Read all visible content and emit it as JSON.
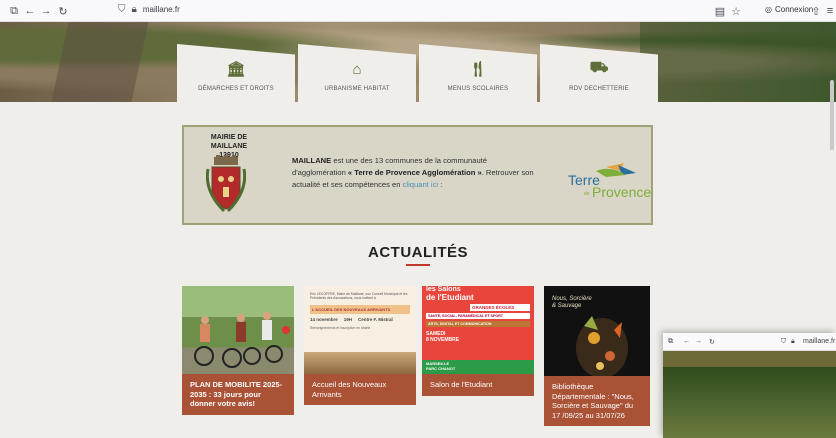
{
  "browser": {
    "url": "maillane.fr",
    "login_label": "Connexion"
  },
  "nav": {
    "items": [
      {
        "label": "DÉMARCHES ET DROITS",
        "icon": "bank-icon"
      },
      {
        "label": "URBANISME HABITAT",
        "icon": "house-icon"
      },
      {
        "label": "MENUS SCOLAIRES",
        "icon": "cutlery-icon"
      },
      {
        "label": "RDV DECHETTERIE",
        "icon": "truck-icon"
      }
    ]
  },
  "mairie": {
    "title_line1": "MAIRIE DE MAILLANE",
    "title_line2": "13910",
    "text_strong": "MAILLANE",
    "text_part1": " est une des 13 communes de la communauté d'agglomération ",
    "text_quote": "« Terre de Provence Agglomération »",
    "text_part2": ". Retrouver son actualité et ses compétences en ",
    "text_link": "cliquant ici",
    "text_end": " :",
    "logo_line1": "Terre",
    "logo_de": "de",
    "logo_line2": "Provence"
  },
  "actualites": {
    "title": "ACTUALITÉS",
    "cards": [
      {
        "caption": "PLAN DE MOBILITE 2025-2035 : 33 jours pour donner votre avis!"
      },
      {
        "caption": "Accueil des Nouveaux Arrivants",
        "poster_intro": "Eric LECOFFRE, Maire de Maillane, son Conseil Municipal et les Présidents des Associations, vous invitent à",
        "poster_band": "L'ACCUEIL DES NOUVEAUX ARRIVANTS",
        "poster_date": "14 novembre",
        "poster_time": "19H",
        "poster_place": "Centre F. Mistral",
        "poster_footer": "Renseignements et inscription en Mairie"
      },
      {
        "caption": "Salon de l'Etudiant",
        "poster_top1": "les Salons",
        "poster_top2": "de l'Etudiant",
        "poster_band1": "GRANDES ÉCOLES",
        "poster_band2": "SANTÉ, SOCIAL, PARAMÉDICAL ET SPORT",
        "poster_band3": "ARTS, DIGITAL ET COMMUNICATION",
        "poster_day": "SAMEDI",
        "poster_date": "8 NOVEMBRE",
        "poster_city": "MARSEILLE",
        "poster_venue": "PARC CHANOT"
      },
      {
        "caption": "Bibliothèque Départementale : \"Nous, Sorcière et Sauvage\" du 17 /09/25 au 31/07/26",
        "poster_title": "Nous, Sorcière & Sauvage"
      }
    ]
  },
  "window2": {
    "url": "maillane.fr"
  }
}
